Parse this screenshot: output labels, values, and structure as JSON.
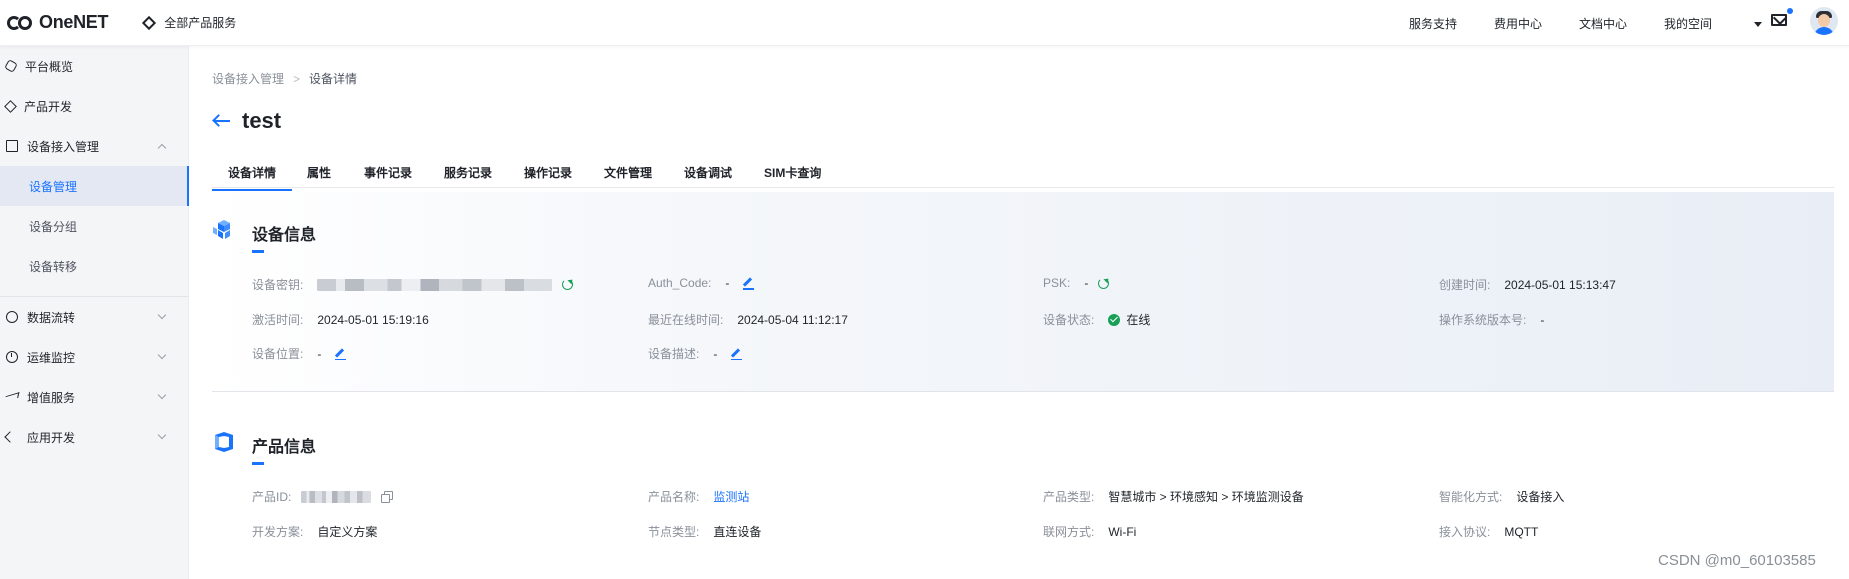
{
  "brand": {
    "logo_text": "OneNET",
    "accent": "#1a73ff"
  },
  "topbar": {
    "all_products": "全部产品服务",
    "nav": [
      "服务支持",
      "费用中心",
      "文档中心",
      "我的空间"
    ]
  },
  "sidebar": {
    "items": [
      {
        "label": "平台概览",
        "icon": "overview-icon"
      },
      {
        "label": "产品开发",
        "icon": "cube-icon"
      },
      {
        "label": "设备接入管理",
        "icon": "device-link-icon",
        "expanded": true
      },
      {
        "label": "数据流转",
        "icon": "data-flow-icon"
      },
      {
        "label": "运维监控",
        "icon": "monitor-icon"
      },
      {
        "label": "增值服务",
        "icon": "send-icon"
      },
      {
        "label": "应用开发",
        "icon": "app-dev-icon"
      }
    ],
    "sub_items": [
      {
        "label": "设备管理",
        "active": true
      },
      {
        "label": "设备分组"
      },
      {
        "label": "设备转移"
      }
    ]
  },
  "breadcrumb": {
    "parent": "设备接入管理",
    "separator": ">",
    "current": "设备详情"
  },
  "page": {
    "title": "test"
  },
  "tabs": [
    "设备详情",
    "属性",
    "事件记录",
    "服务记录",
    "操作记录",
    "文件管理",
    "设备调试",
    "SIM卡查询"
  ],
  "device_info": {
    "title": "设备信息",
    "secret_key_label": "设备密钥:",
    "auth_code_label": "Auth_Code:",
    "auth_code_value": "-",
    "psk_label": "PSK:",
    "psk_value": "-",
    "created_label": "创建时间:",
    "created_value": "2024-05-01 15:13:47",
    "activated_label": "激活时间:",
    "activated_value": "2024-05-01 15:19:16",
    "last_online_label": "最近在线时间:",
    "last_online_value": "2024-05-04 11:12:17",
    "status_label": "设备状态:",
    "status_value": "在线",
    "os_version_label": "操作系统版本号:",
    "os_version_value": "-",
    "location_label": "设备位置:",
    "location_value": "-",
    "description_label": "设备描述:",
    "description_value": "-"
  },
  "product_info": {
    "title": "产品信息",
    "product_id_label": "产品ID:",
    "product_name_label": "产品名称:",
    "product_name_value": "监测站",
    "product_type_label": "产品类型:",
    "product_type_value": "智慧城市 > 环境感知 > 环境监测设备",
    "smart_mode_label": "智能化方式:",
    "smart_mode_value": "设备接入",
    "dev_plan_label": "开发方案:",
    "dev_plan_value": "自定义方案",
    "node_type_label": "节点类型:",
    "node_type_value": "直连设备",
    "network_label": "联网方式:",
    "network_value": "Wi-Fi",
    "protocol_label": "接入协议:",
    "protocol_value": "MQTT"
  },
  "watermark": "CSDN @m0_60103585"
}
